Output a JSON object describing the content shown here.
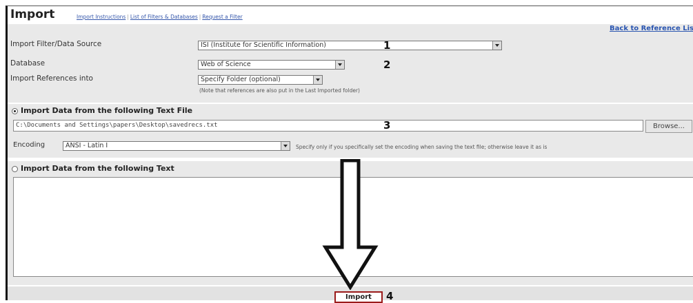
{
  "header": {
    "title": "Import",
    "links": [
      "Import Instructions",
      "List of Filters & Databases",
      "Request a Filter"
    ],
    "separator": "|",
    "back_link": "Back to Reference Lis"
  },
  "form": {
    "filter_label": "Import Filter/Data Source",
    "filter_value": "ISI (Institute for Scientific Information)",
    "filter_step": "1",
    "database_label": "Database",
    "database_value": "Web of Science",
    "database_step": "2",
    "import_into_label": "Import References into",
    "import_into_value": "Specify Folder (optional)",
    "import_into_note": "(Note that references are also put in the Last Imported folder)"
  },
  "file_section": {
    "heading": "Import Data from the following Text File",
    "selected": true,
    "file_path": "C:\\Documents and Settings\\papers\\Desktop\\savedrecs.txt",
    "file_step": "3",
    "browse_label": "Browse...",
    "encoding_label": "Encoding",
    "encoding_value": "ANSI - Latin I",
    "encoding_note": "Specify only if you specifically set the encoding when saving the text file; otherwise leave it as is"
  },
  "text_section": {
    "heading": "Import Data from the following Text",
    "selected": false,
    "text_value": ""
  },
  "footer": {
    "import_label": "Import",
    "import_step": "4"
  },
  "colors": {
    "link": "#3355aa",
    "band": "#e9e9e9",
    "import_border": "#9a1a1a"
  }
}
